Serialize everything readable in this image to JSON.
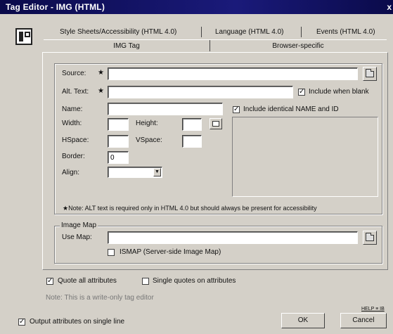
{
  "window": {
    "title": "Tag Editor - IMG  (HTML)",
    "close": "x"
  },
  "tabs": {
    "back": [
      "Style Sheets/Accessibility (HTML 4.0)",
      "Language (HTML 4.0)",
      "Events (HTML 4.0)"
    ],
    "front": [
      "IMG Tag",
      "Browser-specific"
    ],
    "active": "IMG Tag"
  },
  "form": {
    "source": {
      "label": "Source:",
      "marker": "★",
      "value": ""
    },
    "alt": {
      "label": "Alt. Text:",
      "marker": "★",
      "value": ""
    },
    "include_when_blank": {
      "label": "Include when blank",
      "checked": true
    },
    "name": {
      "label": "Name:",
      "value": ""
    },
    "include_identical": {
      "label": "Include identical NAME and ID",
      "checked": true
    },
    "width": {
      "label": "Width:",
      "value": ""
    },
    "height": {
      "label": "Height:",
      "value": ""
    },
    "hspace": {
      "label": "HSpace:",
      "value": ""
    },
    "vspace": {
      "label": "VSpace:",
      "value": ""
    },
    "border": {
      "label": "Border:",
      "value": "0"
    },
    "align": {
      "label": "Align:",
      "value": ""
    },
    "alt_note": "★Note: ALT text is required only in HTML 4.0 but should always be present for accessibility"
  },
  "image_map": {
    "group_label": "Image Map",
    "use_map": {
      "label": "Use Map:",
      "value": ""
    },
    "ismap": {
      "label": "ISMAP (Server-side Image Map)",
      "checked": false
    }
  },
  "options": {
    "quote_all": {
      "label": "Quote all attributes",
      "checked": true
    },
    "single_quotes": {
      "label": "Single quotes on attributes",
      "checked": false
    },
    "note": "Note: This is a write-only tag editor",
    "single_line": {
      "label": "Output attributes on single line",
      "checked": true
    }
  },
  "footer": {
    "help_link": "HELP ≡ IB",
    "ok": "OK",
    "cancel": "Cancel"
  },
  "icons": [
    "tag-editor-icon",
    "folder-browse-icon",
    "image-dimension-icon",
    "dropdown-arrow-icon",
    "checkbox-icon"
  ]
}
